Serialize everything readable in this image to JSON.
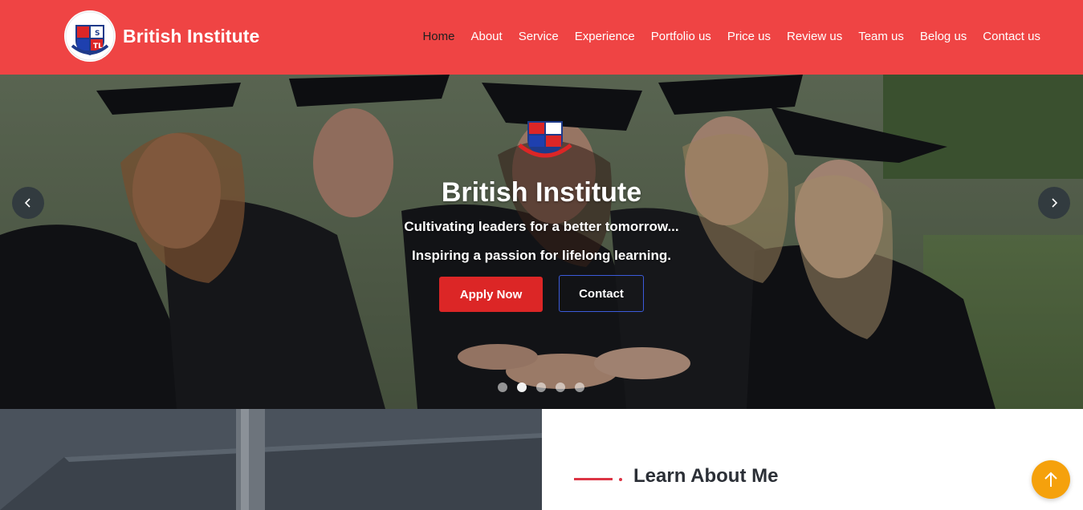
{
  "brand": {
    "name": "British Institute",
    "logo_icon": "institute-crest-icon"
  },
  "nav": {
    "items": [
      {
        "label": "Home",
        "active": true
      },
      {
        "label": "About"
      },
      {
        "label": "Service"
      },
      {
        "label": "Experience"
      },
      {
        "label": "Portfolio us"
      },
      {
        "label": "Price us"
      },
      {
        "label": "Review us"
      },
      {
        "label": "Team us"
      },
      {
        "label": "Belog us"
      },
      {
        "label": "Contact us"
      }
    ]
  },
  "hero": {
    "title": "British Institute",
    "subtitle1": "Cultivating leaders for a better tomorrow...",
    "subtitle2": "Inspiring a passion for lifelong learning.",
    "apply_label": "Apply Now",
    "contact_label": "Contact",
    "prev_icon": "chevron-left-icon",
    "next_icon": "chevron-right-icon",
    "slide_count": 5,
    "active_slide": 2
  },
  "about": {
    "title": "Learn About Me"
  },
  "scroll_top_icon": "arrow-up-icon",
  "colors": {
    "navbar": "#ef4444",
    "apply_button": "#dc2626",
    "contact_border": "#3b5bdb",
    "accent_line": "#dc3545",
    "scroll_top": "#f5a10c"
  }
}
